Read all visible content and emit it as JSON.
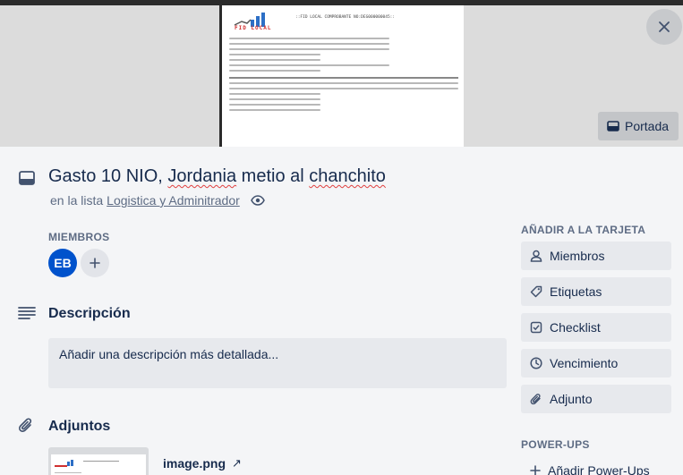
{
  "cover": {
    "doc_header": "::FID LOCAL COMPROBANTE NO:DEG000000045::",
    "doc_logo_text": "FID LOCAL",
    "portada_label": "Portada",
    "portada_icon": "card-icon",
    "close_icon": "close-icon"
  },
  "card": {
    "title_plain": "Gasto 10 NIO, ",
    "title_sq1": "Jordania",
    "title_mid": " metio al ",
    "title_sq2": "chanchito",
    "list_prefix": "en la lista",
    "list_name": "Logistica y Adminitrador"
  },
  "members": {
    "label": "MIEMBROS",
    "avatar_initials": "EB"
  },
  "description": {
    "heading": "Descripción",
    "placeholder": "Añadir una descripción más detallada..."
  },
  "attachments": {
    "heading": "Adjuntos",
    "file_name": "image.png",
    "open_icon": "↗"
  },
  "sidebar": {
    "add_label": "AÑADIR A LA TARJETA",
    "buttons": [
      {
        "label": "Miembros",
        "icon": "person-icon"
      },
      {
        "label": "Etiquetas",
        "icon": "tag-icon"
      },
      {
        "label": "Checklist",
        "icon": "checkbox-icon"
      },
      {
        "label": "Vencimiento",
        "icon": "clock-icon"
      },
      {
        "label": "Adjunto",
        "icon": "paperclip-icon"
      }
    ],
    "powerups_label": "POWER-UPS",
    "add_powerups": "Añadir Power-Ups"
  },
  "colors": {
    "background": "#f4f5f7",
    "avatar": "#0052cc",
    "button": "#e7e9ed",
    "text": "#172b4d",
    "muted": "#5e6c84"
  }
}
